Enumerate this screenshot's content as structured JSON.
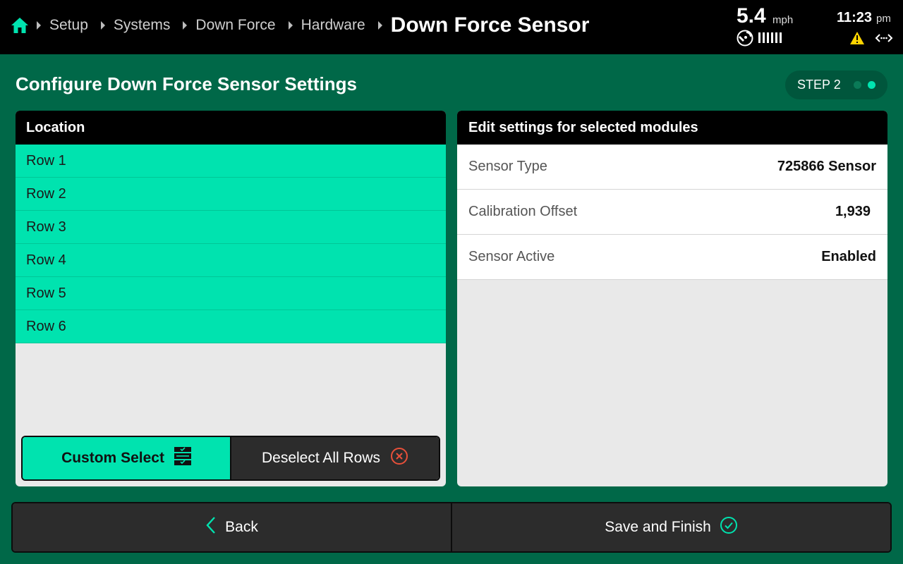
{
  "topbar": {
    "breadcrumbs": [
      {
        "label": "Setup"
      },
      {
        "label": "Systems"
      },
      {
        "label": "Down Force"
      },
      {
        "label": "Hardware"
      }
    ],
    "current_page": "Down Force Sensor",
    "speed": {
      "value": "5.4",
      "unit": "mph"
    },
    "time": {
      "value": "11:23",
      "ampm": "pm"
    }
  },
  "heading": {
    "title": "Configure Down Force Sensor Settings",
    "step_label": "STEP 2"
  },
  "location_panel": {
    "header": "Location",
    "rows": [
      "Row 1",
      "Row 2",
      "Row 3",
      "Row 4",
      "Row 5",
      "Row 6"
    ],
    "custom_select_label": "Custom Select",
    "deselect_label": "Deselect All Rows"
  },
  "settings_panel": {
    "header": "Edit settings for selected modules",
    "settings": [
      {
        "label": "Sensor Type",
        "value": "725866 Sensor"
      },
      {
        "label": "Calibration Offset",
        "value": "1,939"
      },
      {
        "label": "Sensor Active",
        "value": "Enabled"
      }
    ]
  },
  "footer": {
    "back_label": "Back",
    "save_label": "Save and Finish"
  },
  "colors": {
    "background": "#006848",
    "accent": "#00e3af",
    "warning": "#ffd400",
    "error": "#e8503a"
  }
}
